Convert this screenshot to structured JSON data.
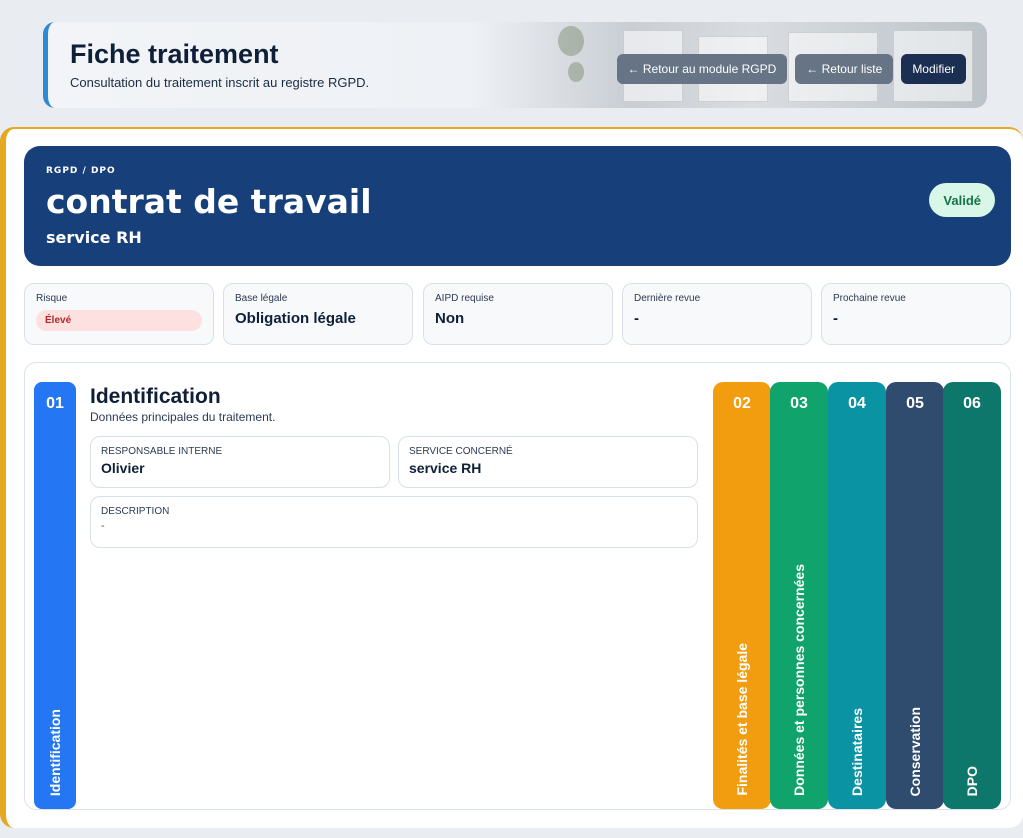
{
  "header": {
    "title": "Fiche traitement",
    "subtitle": "Consultation du traitement inscrit au registre RGPD.",
    "buttons": {
      "back_module": "← Retour au module RGPD",
      "back_list": "← Retour liste",
      "edit": "Modifier"
    }
  },
  "hero": {
    "eyebrow": "RGPD / DPO",
    "title": "contrat de travail",
    "subtitle": "service RH",
    "status": "Validé"
  },
  "stats": [
    {
      "label": "Risque",
      "value": "Élevé",
      "type": "pill"
    },
    {
      "label": "Base légale",
      "value": "Obligation légale"
    },
    {
      "label": "AIPD requise",
      "value": "Non"
    },
    {
      "label": "Dernière revue",
      "value": "-"
    },
    {
      "label": "Prochaine revue",
      "value": "-"
    }
  ],
  "sections": [
    {
      "num": "01",
      "label": "Identification",
      "color": "#2476f3",
      "active": true
    },
    {
      "num": "02",
      "label": "Finalités et base légale",
      "color": "#f19d0f"
    },
    {
      "num": "03",
      "label": "Données et personnes concernées",
      "color": "#10a36b"
    },
    {
      "num": "04",
      "label": "Destinataires",
      "color": "#0a93a2"
    },
    {
      "num": "05",
      "label": "Conservation",
      "color": "#2f4b6e"
    },
    {
      "num": "06",
      "label": "DPO",
      "color": "#0e776c"
    }
  ],
  "panel": {
    "title": "Identification",
    "subtitle": "Données principales du traitement.",
    "fields": {
      "responsable": {
        "label": "RESPONSABLE INTERNE",
        "value": "Olivier"
      },
      "service": {
        "label": "SERVICE CONCERNÉ",
        "value": "service RH"
      },
      "description": {
        "label": "DESCRIPTION",
        "value": "-"
      }
    }
  }
}
